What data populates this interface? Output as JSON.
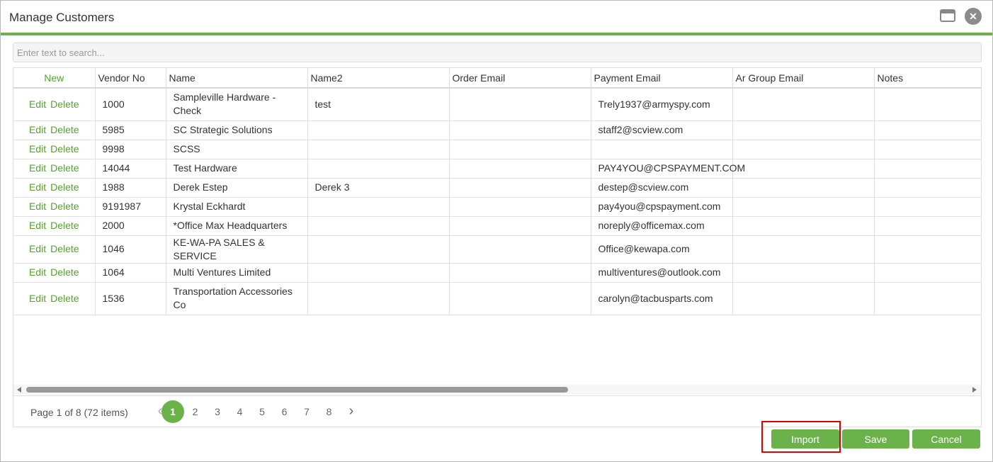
{
  "dialog": {
    "title": "Manage Customers"
  },
  "search": {
    "placeholder": "Enter text to search..."
  },
  "grid": {
    "new_label": "New",
    "columns": [
      "Vendor No",
      "Name",
      "Name2",
      "Order Email",
      "Payment Email",
      "Ar Group Email",
      "Notes"
    ],
    "edit_label": "Edit",
    "delete_label": "Delete",
    "rows": [
      {
        "vendor_no": "1000",
        "name": "Sampleville Hardware - Check",
        "name2": "test",
        "order_email": "",
        "payment_email": "Trely1937@armyspy.com",
        "ar_group_email": "",
        "notes": ""
      },
      {
        "vendor_no": "5985",
        "name": "SC Strategic Solutions",
        "name2": "",
        "order_email": "",
        "payment_email": "staff2@scview.com",
        "ar_group_email": "",
        "notes": ""
      },
      {
        "vendor_no": "9998",
        "name": "SCSS",
        "name2": "",
        "order_email": "",
        "payment_email": "",
        "ar_group_email": "",
        "notes": ""
      },
      {
        "vendor_no": "14044",
        "name": "Test Hardware",
        "name2": "",
        "order_email": "",
        "payment_email": "PAY4YOU@CPSPAYMENT.COM",
        "ar_group_email": "",
        "notes": ""
      },
      {
        "vendor_no": "1988",
        "name": "Derek Estep",
        "name2": "Derek 3",
        "order_email": "",
        "payment_email": "destep@scview.com",
        "ar_group_email": "",
        "notes": ""
      },
      {
        "vendor_no": "9191987",
        "name": "Krystal Eckhardt",
        "name2": "",
        "order_email": "",
        "payment_email": "pay4you@cpspayment.com",
        "ar_group_email": "",
        "notes": ""
      },
      {
        "vendor_no": "2000",
        "name": "*Office Max Headquarters",
        "name2": "",
        "order_email": "",
        "payment_email": "noreply@officemax.com",
        "ar_group_email": "",
        "notes": ""
      },
      {
        "vendor_no": "1046",
        "name": "KE-WA-PA SALES & SERVICE",
        "name2": "",
        "order_email": "",
        "payment_email": "Office@kewapa.com",
        "ar_group_email": "",
        "notes": ""
      },
      {
        "vendor_no": "1064",
        "name": "Multi Ventures Limited",
        "name2": "",
        "order_email": "",
        "payment_email": "multiventures@outlook.com",
        "ar_group_email": "",
        "notes": ""
      },
      {
        "vendor_no": "1536",
        "name": "Transportation Accessories Co",
        "name2": "",
        "order_email": "",
        "payment_email": "carolyn@tacbusparts.com",
        "ar_group_email": "",
        "notes": ""
      }
    ]
  },
  "pager": {
    "info": "Page 1 of 8 (72 items)",
    "pages": [
      "1",
      "2",
      "3",
      "4",
      "5",
      "6",
      "7",
      "8"
    ],
    "current": "1"
  },
  "buttons": {
    "import": "Import",
    "save": "Save",
    "cancel": "Cancel"
  },
  "colors": {
    "accent": "#6bb24a",
    "highlight": "#e00000"
  },
  "icons": {
    "maximize": "window-maximize-icon",
    "close": "close-icon",
    "prev": "chevron-left-icon",
    "next": "chevron-right-icon"
  }
}
